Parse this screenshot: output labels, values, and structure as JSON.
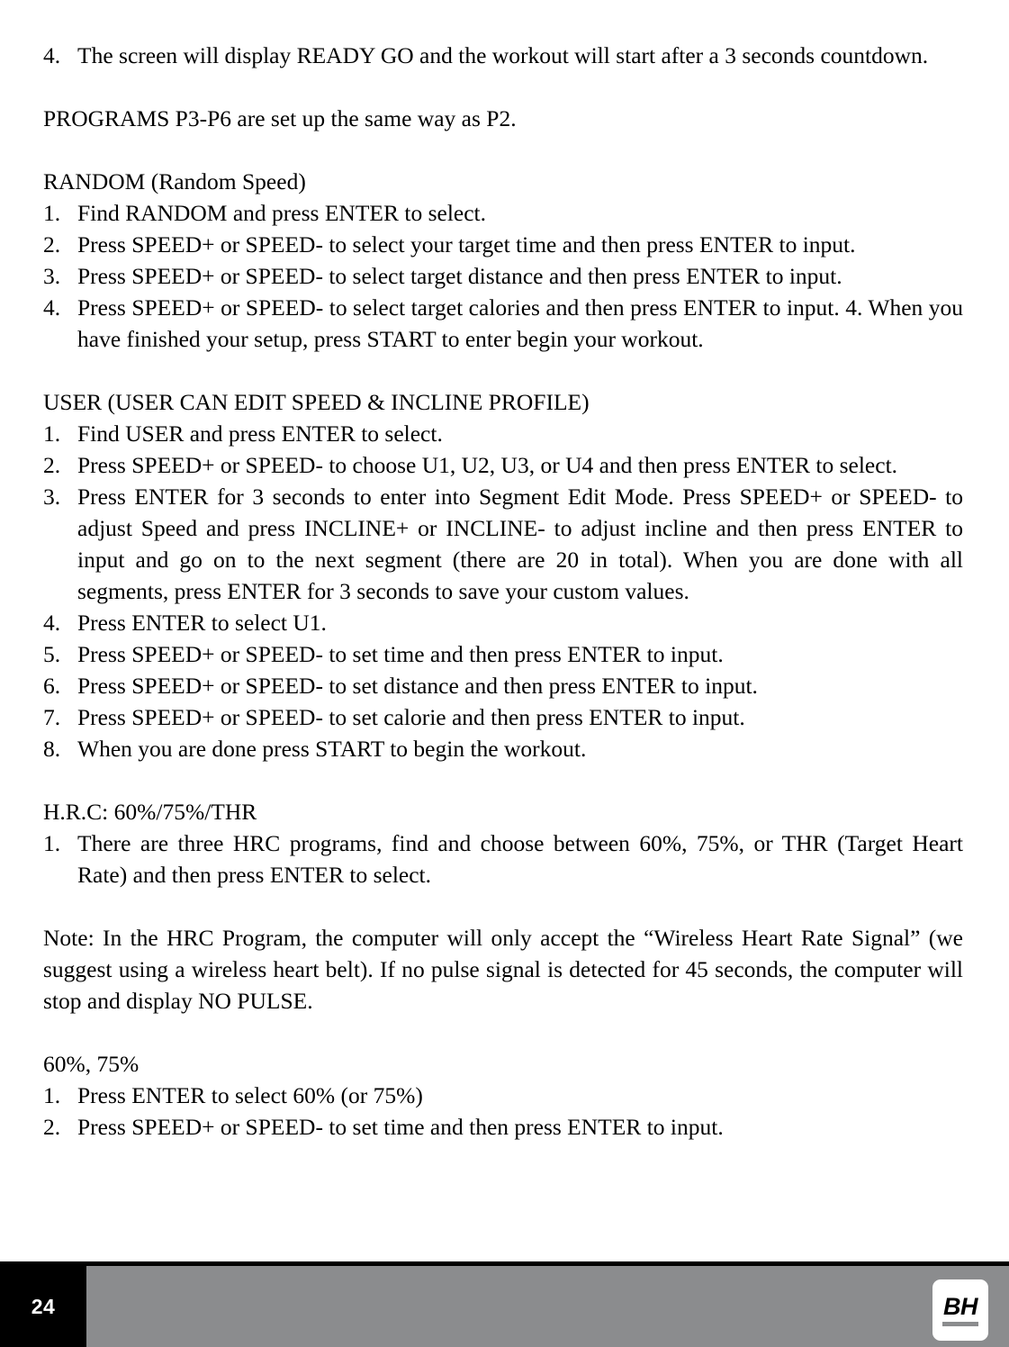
{
  "document": {
    "page_number": "24",
    "logo_text": "BH",
    "colors": {
      "footer_gray": "#8b8c8e",
      "footer_black": "#000000",
      "text": "#000000",
      "page_background": "#ffffff"
    }
  },
  "body": {
    "item_p2_4": {
      "num": "4.",
      "text": "The screen will display READY GO and the workout will start after a 3 seconds countdown."
    },
    "programs_note": "PROGRAMS P3-P6 are set up the same way as P2.",
    "random": {
      "heading": "RANDOM (Random Speed)",
      "items": [
        {
          "num": "1.",
          "text": "Find RANDOM and press ENTER to select."
        },
        {
          "num": "2.",
          "text": "Press SPEED+ or SPEED- to select your target time and then press ENTER to input."
        },
        {
          "num": "3.",
          "text": "Press SPEED+ or SPEED- to select target distance and then press ENTER to input."
        },
        {
          "num": "4.",
          "text": "Press SPEED+ or SPEED- to select target calories and then press ENTER to input. 4. When you have finished your setup, press START to enter begin your workout."
        }
      ]
    },
    "user": {
      "heading": "USER (USER CAN EDIT SPEED & INCLINE PROFILE)",
      "items": [
        {
          "num": "1.",
          "text": "Find USER and press ENTER to select."
        },
        {
          "num": "2.",
          "text": "Press SPEED+ or SPEED- to choose U1, U2, U3, or U4 and then press ENTER to select."
        },
        {
          "num": "3.",
          "text": "Press ENTER for 3 seconds to enter into Segment Edit Mode. Press SPEED+ or SPEED- to adjust Speed and press INCLINE+ or INCLINE- to adjust incline and then press ENTER to input and go on to the next segment (there are 20 in total). When you are done with all segments, press ENTER for 3 seconds to save your custom values."
        },
        {
          "num": "4.",
          "text": "Press ENTER to select U1."
        },
        {
          "num": "5.",
          "text": "Press SPEED+ or SPEED- to set time and then press ENTER to input."
        },
        {
          "num": "6.",
          "text": "Press SPEED+ or SPEED- to set distance and then press ENTER to input."
        },
        {
          "num": "7.",
          "text": "Press SPEED+ or SPEED- to set calorie and then press ENTER to input."
        },
        {
          "num": "8.",
          "text": "When you are done press START to begin the workout."
        }
      ]
    },
    "hrc": {
      "heading": "H.R.C: 60%/75%/THR",
      "items": [
        {
          "num": "1.",
          "text": "There are three HRC programs, find and choose between 60%, 75%, or THR (Target Heart Rate) and then press ENTER to select."
        }
      ],
      "note": "Note: In the HRC Program, the computer will only accept the “Wireless Heart Rate Signal” (we suggest using a wireless heart belt). If no pulse signal is detected for 45 seconds, the computer will stop and display NO PULSE."
    },
    "percent": {
      "heading": "60%, 75%",
      "items": [
        {
          "num": "1.",
          "text": "Press ENTER to select 60% (or 75%)"
        },
        {
          "num": "2.",
          "text": "Press SPEED+ or SPEED- to set time and then press ENTER to input."
        }
      ]
    }
  }
}
